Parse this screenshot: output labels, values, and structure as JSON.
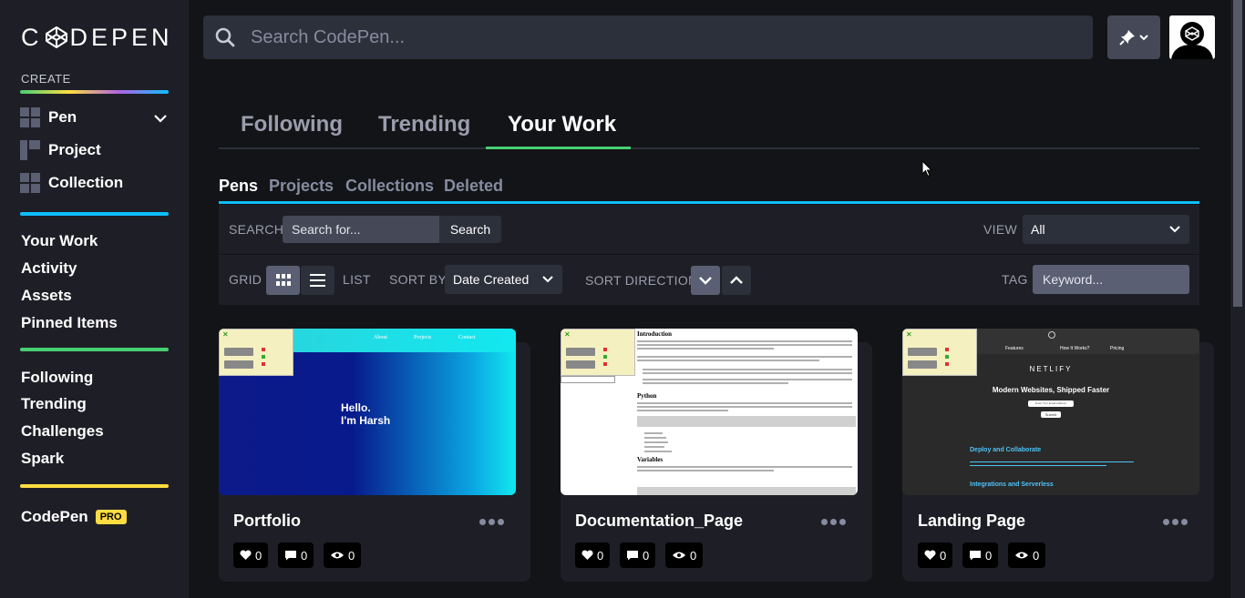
{
  "brand": {
    "logo_text": "CODEPEN"
  },
  "sidebar": {
    "create_label": "CREATE",
    "create_items": [
      {
        "label": "Pen",
        "icon": "pen-grid-icon"
      },
      {
        "label": "Project",
        "icon": "project-icon"
      },
      {
        "label": "Collection",
        "icon": "collection-icon"
      }
    ],
    "main_links": [
      "Your Work",
      "Activity",
      "Assets",
      "Pinned Items"
    ],
    "secondary_links": [
      "Following",
      "Trending",
      "Challenges",
      "Spark"
    ],
    "codepen_pro": {
      "label": "CodePen",
      "badge": "PRO"
    },
    "bar_colors": {
      "create": "#0ebeff",
      "main": "#47cf73",
      "secondary": "#ffdd40"
    }
  },
  "topbar": {
    "search_placeholder": "Search CodePen..."
  },
  "main_tabs": [
    {
      "label": "Following",
      "active": false
    },
    {
      "label": "Trending",
      "active": false
    },
    {
      "label": "Your Work",
      "active": true
    }
  ],
  "sub_tabs": [
    {
      "label": "Pens",
      "active": true
    },
    {
      "label": "Projects",
      "active": false
    },
    {
      "label": "Collections",
      "active": false
    },
    {
      "label": "Deleted",
      "active": false
    }
  ],
  "filters": {
    "search_label": "SEARCH",
    "search_placeholder": "Search for...",
    "search_button": "Search",
    "view_label": "VIEW",
    "view_value": "All",
    "grid_label": "GRID",
    "list_label": "LIST",
    "sort_by_label": "SORT BY",
    "sort_by_value": "Date Created",
    "sort_direction_label": "SORT DIRECTION",
    "tag_label": "TAG",
    "tag_placeholder": "Keyword..."
  },
  "cards": [
    {
      "title": "Portfolio",
      "likes": "0",
      "comments": "0",
      "views": "0",
      "thumb": {
        "nav": [
          "About",
          "Projects",
          "Contact"
        ],
        "hello": "Hello.",
        "name": "I'm Harsh"
      }
    },
    {
      "title": "Documentation_Page",
      "likes": "0",
      "comments": "0",
      "views": "0",
      "thumb": {
        "h1": "Introduction",
        "h2": "Python",
        "h3": "Variables"
      }
    },
    {
      "title": "Landing Page",
      "likes": "0",
      "comments": "0",
      "views": "0",
      "thumb": {
        "nav": [
          "Features",
          "How It Works?",
          "Pricing"
        ],
        "brand": "NETLIFY",
        "headline": "Modern Websites, Shipped Faster",
        "email_placeholder": "Enter Your Email Address",
        "submit": "Submit",
        "section1": "Deploy and Collaborate",
        "section2": "Integrations and Serverless"
      }
    }
  ]
}
